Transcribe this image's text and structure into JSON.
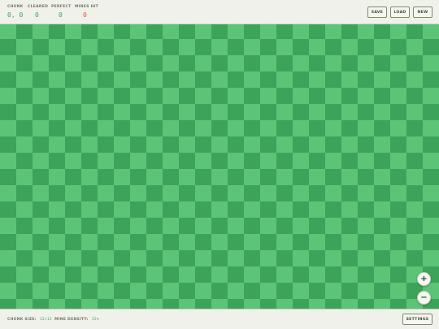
{
  "stats": [
    {
      "label": "CHUNK",
      "value": "0, 0",
      "highlight": false
    },
    {
      "label": "CLEARED",
      "value": "0",
      "highlight": false
    },
    {
      "label": "PERFECT",
      "value": "0",
      "highlight": false
    },
    {
      "label": "MINES HIT",
      "value": "0",
      "highlight": true
    }
  ],
  "buttons": {
    "save": "SAVE",
    "load": "LOAD",
    "new": "NEW",
    "settings": "SETTINGS"
  },
  "zoom": {
    "in": "+",
    "out": "−"
  },
  "footer": {
    "chunk_size_label": "CHUNK SIZE:",
    "chunk_size_value": "12×12",
    "mine_density_label": "MINE DENSITY:",
    "mine_density_value": "15%"
  },
  "board": {
    "light_color": "#5bc476",
    "dark_color": "#3da35a",
    "columns": 27,
    "rows": 18
  },
  "colors": {
    "accent_green": "#3ba558",
    "mine_red": "#e0554d",
    "bar_bg": "#eff1ea"
  }
}
